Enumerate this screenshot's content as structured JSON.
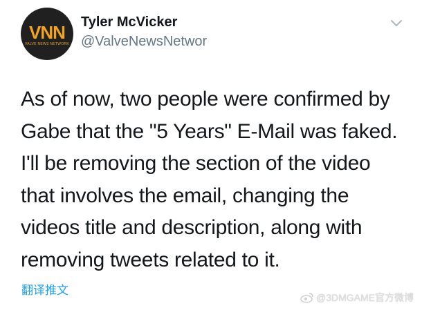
{
  "author": {
    "name": "Tyler McVicker",
    "handle": "@ValveNewsNetwor",
    "avatar_logo": "VNN",
    "avatar_subtitle": "VALVE NEWS NETWORK"
  },
  "tweet": {
    "text": "As of now, two people were confirmed by\nGabe that the \"5 Years\" E-Mail was faked.\nI'll be removing the section of the video\nthat involves the email, changing the\nvideos title and description, along with\nremoving tweets related to it."
  },
  "actions": {
    "translate_label": "翻译推文",
    "menu_icon": "chevron-down-icon"
  },
  "watermark": {
    "text": "@3DMGAME官方微博",
    "icon": "weibo-icon"
  },
  "colors": {
    "link": "#1da1f2",
    "handle": "#657786",
    "text": "#14171a",
    "logo": "#f2a31f"
  }
}
